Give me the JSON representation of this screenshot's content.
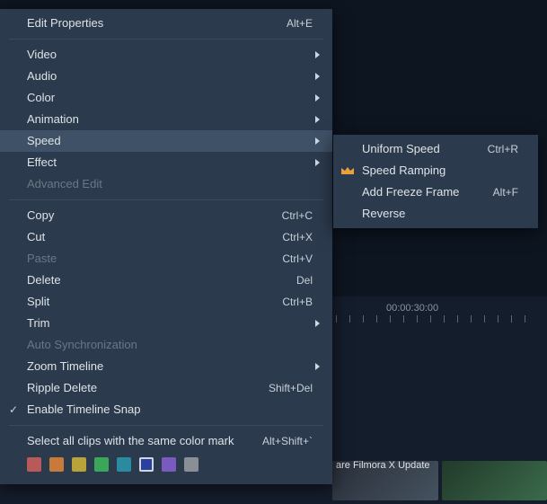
{
  "ruler": {
    "timecode": "00:00:30:00"
  },
  "thumb_label": "are Filmora X Update",
  "menu": {
    "edit_properties": {
      "label": "Edit Properties",
      "accel": "Alt+E"
    },
    "video": {
      "label": "Video"
    },
    "audio": {
      "label": "Audio"
    },
    "color": {
      "label": "Color"
    },
    "animation": {
      "label": "Animation"
    },
    "speed": {
      "label": "Speed"
    },
    "effect": {
      "label": "Effect"
    },
    "advanced_edit": {
      "label": "Advanced Edit"
    },
    "copy": {
      "label": "Copy",
      "accel": "Ctrl+C"
    },
    "cut": {
      "label": "Cut",
      "accel": "Ctrl+X"
    },
    "paste": {
      "label": "Paste",
      "accel": "Ctrl+V"
    },
    "delete": {
      "label": "Delete",
      "accel": "Del"
    },
    "split": {
      "label": "Split",
      "accel": "Ctrl+B"
    },
    "trim": {
      "label": "Trim"
    },
    "auto_sync": {
      "label": "Auto Synchronization"
    },
    "zoom_timeline": {
      "label": "Zoom Timeline"
    },
    "ripple_delete": {
      "label": "Ripple Delete",
      "accel": "Shift+Del"
    },
    "snap": {
      "label": "Enable Timeline Snap"
    },
    "select_color_mark": {
      "label": "Select all clips with the same color mark",
      "accel": "Alt+Shift+`"
    }
  },
  "submenu": {
    "uniform_speed": {
      "label": "Uniform Speed",
      "accel": "Ctrl+R"
    },
    "speed_ramping": {
      "label": "Speed Ramping"
    },
    "add_freeze": {
      "label": "Add Freeze Frame",
      "accel": "Alt+F"
    },
    "reverse": {
      "label": "Reverse"
    }
  },
  "swatches": {
    "c0": "#b85a5a",
    "c1": "#c77a3a",
    "c2": "#b9a23a",
    "c3": "#3aa65a",
    "c4": "#2a8aa0",
    "c5": "#2a3fa0",
    "c6": "#7a5abf",
    "c7": "#8a8f96",
    "selected_index": 5
  }
}
